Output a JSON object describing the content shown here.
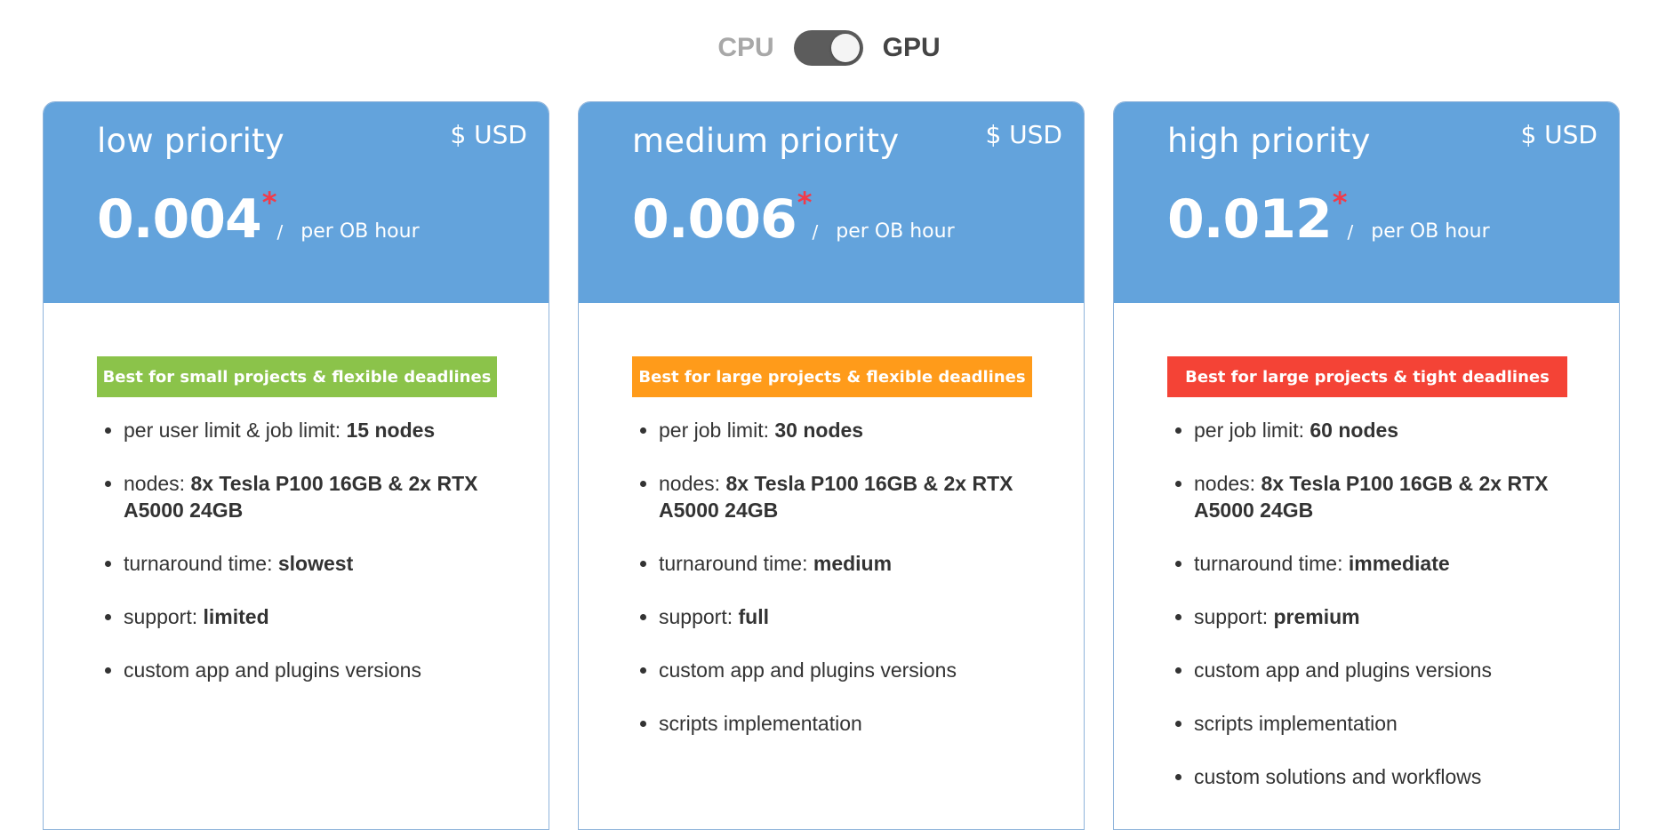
{
  "toggle": {
    "left_label": "CPU",
    "right_label": "GPU",
    "selected": "GPU"
  },
  "colors": {
    "header_blue": "#63a3dc",
    "badge_green": "#8bc34a",
    "badge_orange": "#ff9b1a",
    "badge_red": "#f44336",
    "asterisk_red": "#f23b4a"
  },
  "plans": [
    {
      "title": "low priority",
      "currency": "$ USD",
      "price": "0.004",
      "asterisk": "*",
      "slash": "/",
      "unit": "per OB hour",
      "badge": "Best for small projects & flexible deadlines",
      "badge_color": "#8bc34a",
      "features": [
        {
          "label": "per user limit & job limit: ",
          "value": "15 nodes"
        },
        {
          "label": "nodes: ",
          "value": "8x Tesla P100 16GB & 2x RTX A5000 24GB"
        },
        {
          "label": "turnaround time: ",
          "value": "slowest"
        },
        {
          "label": "support: ",
          "value": "limited"
        },
        {
          "label": "custom app and plugins versions",
          "value": ""
        }
      ]
    },
    {
      "title": "medium priority",
      "currency": "$ USD",
      "price": "0.006",
      "asterisk": "*",
      "slash": "/",
      "unit": "per OB hour",
      "badge": "Best for large projects & flexible deadlines",
      "badge_color": "#ff9b1a",
      "features": [
        {
          "label": "per job limit: ",
          "value": "30 nodes"
        },
        {
          "label": "nodes: ",
          "value": "8x Tesla P100 16GB & 2x RTX A5000 24GB"
        },
        {
          "label": "turnaround time: ",
          "value": "medium"
        },
        {
          "label": "support: ",
          "value": "full"
        },
        {
          "label": "custom app and plugins versions",
          "value": ""
        },
        {
          "label": "scripts implementation",
          "value": ""
        }
      ]
    },
    {
      "title": "high priority",
      "currency": "$ USD",
      "price": "0.012",
      "asterisk": "*",
      "slash": "/",
      "unit": "per OB hour",
      "badge": "Best for large projects & tight deadlines",
      "badge_color": "#f44336",
      "features": [
        {
          "label": "per job limit: ",
          "value": "60 nodes"
        },
        {
          "label": "nodes: ",
          "value": "8x Tesla P100 16GB & 2x RTX A5000 24GB"
        },
        {
          "label": "turnaround time: ",
          "value": "immediate"
        },
        {
          "label": "support: ",
          "value": "premium"
        },
        {
          "label": "custom app and plugins versions",
          "value": ""
        },
        {
          "label": "scripts implementation",
          "value": ""
        },
        {
          "label": "custom solutions and workflows",
          "value": ""
        }
      ]
    }
  ]
}
